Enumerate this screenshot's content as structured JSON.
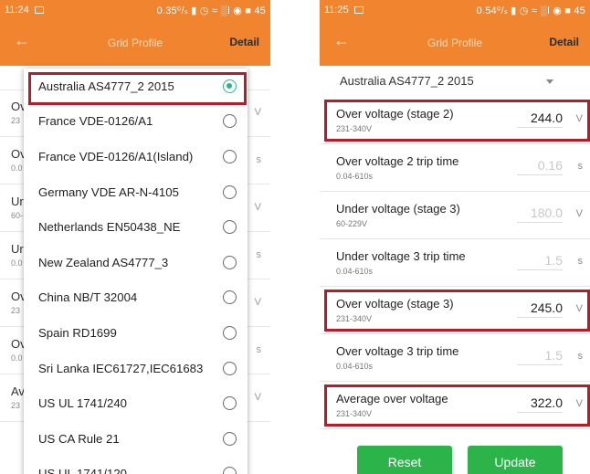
{
  "left": {
    "status": {
      "time": "11:24",
      "right": "0.35⁰/ₛ ▮ ◷ ≈ ░l ◉ ■ 45"
    },
    "app_bar": {
      "title": "Grid Profile",
      "detail": "Detail"
    },
    "bg_rows": [
      {
        "title": "Ov",
        "sub": "23",
        "unit": "V"
      },
      {
        "title": "Ov",
        "sub": "0.0",
        "unit": "s"
      },
      {
        "title": "Ur",
        "sub": "60-",
        "unit": "V"
      },
      {
        "title": "Ur",
        "sub": "0.0",
        "unit": "s"
      },
      {
        "title": "Ov",
        "sub": "23",
        "unit": "V"
      },
      {
        "title": "Ov",
        "sub": "0.0",
        "unit": "s"
      },
      {
        "title": "Av",
        "sub": "23",
        "unit": "V"
      }
    ],
    "dropdown": [
      {
        "label": "Australia AS4777_2 2015",
        "selected": true
      },
      {
        "label": "France VDE-0126/A1",
        "selected": false
      },
      {
        "label": "France VDE-0126/A1(Island)",
        "selected": false
      },
      {
        "label": "Germany VDE AR-N-4105",
        "selected": false
      },
      {
        "label": "Netherlands EN50438_NE",
        "selected": false
      },
      {
        "label": "New Zealand AS4777_3",
        "selected": false
      },
      {
        "label": "China NB/T 32004",
        "selected": false
      },
      {
        "label": "Spain RD1699",
        "selected": false
      },
      {
        "label": "Sri Lanka IEC61727,IEC61683",
        "selected": false
      },
      {
        "label": "US UL 1741/240",
        "selected": false
      },
      {
        "label": "US CA Rule 21",
        "selected": false
      },
      {
        "label": "US UL 1741/120",
        "selected": false
      }
    ]
  },
  "right": {
    "status": {
      "time": "11:25",
      "right": "0.54⁰/ₛ ▮ ◷ ≈ ░l ◉ ■ 45"
    },
    "app_bar": {
      "title": "Grid Profile",
      "detail": "Detail"
    },
    "profile": "Australia AS4777_2 2015",
    "params": [
      {
        "label": "Over voltage (stage 2)",
        "range": "231-340V",
        "value": "244.0",
        "unit": "V",
        "disabled": false
      },
      {
        "label": "Over voltage 2 trip time",
        "range": "0.04-610s",
        "value": "0.16",
        "unit": "s",
        "disabled": true
      },
      {
        "label": "Under voltage (stage 3)",
        "range": "60-229V",
        "value": "180.0",
        "unit": "V",
        "disabled": true
      },
      {
        "label": "Under voltage 3 trip time",
        "range": "0.04-610s",
        "value": "1.5",
        "unit": "s",
        "disabled": true
      },
      {
        "label": "Over voltage (stage 3)",
        "range": "231-340V",
        "value": "245.0",
        "unit": "V",
        "disabled": false
      },
      {
        "label": "Over voltage 3 trip time",
        "range": "0.04-610s",
        "value": "1.5",
        "unit": "s",
        "disabled": true
      },
      {
        "label": "Average over voltage",
        "range": "231-340V",
        "value": "322.0",
        "unit": "V",
        "disabled": false
      }
    ],
    "reset_label": "Reset",
    "update_label": "Update"
  },
  "colors": {
    "app_bar": "#f0842f",
    "highlight": "#b71c2a",
    "button": "#2cb44b",
    "radio_selected": "#27b58f"
  }
}
